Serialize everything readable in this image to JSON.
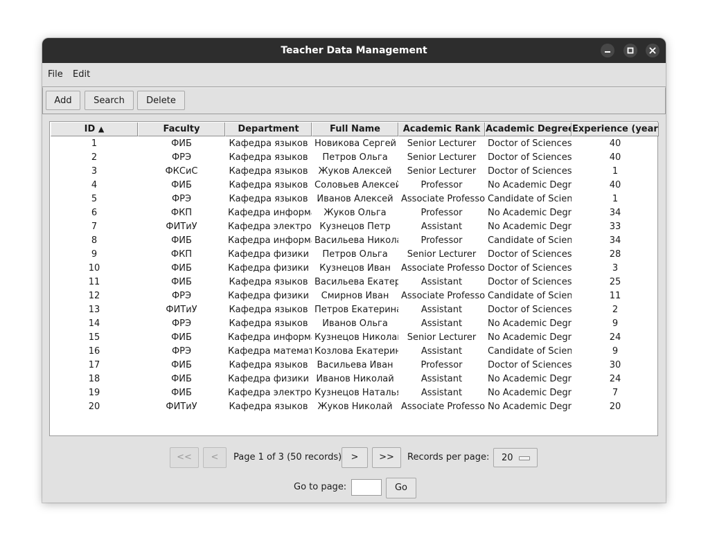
{
  "window": {
    "title": "Teacher Data Management",
    "controls": {
      "minimize": "minimize-icon",
      "maximize": "maximize-icon",
      "close": "close-icon"
    }
  },
  "menu": [
    "File",
    "Edit"
  ],
  "toolbar": {
    "add_label": "Add",
    "search_label": "Search",
    "delete_label": "Delete"
  },
  "table": {
    "columns": [
      "ID",
      "Faculty",
      "Department",
      "Full Name",
      "Academic Rank",
      "Academic Degree",
      "Experience (years)"
    ],
    "sort": {
      "column": "ID",
      "indicator": "▲"
    },
    "rows": [
      [
        "1",
        "ФИБ",
        "Кафедра языков",
        "Новикова Сергей",
        "Senior Lecturer",
        "Doctor of Sciences",
        "40"
      ],
      [
        "2",
        "ФРЭ",
        "Кафедра языков",
        "Петров Ольга",
        "Senior Lecturer",
        "Doctor of Sciences",
        "40"
      ],
      [
        "3",
        "ФКСиС",
        "Кафедра языков",
        "Жуков Алексей",
        "Senior Lecturer",
        "Doctor of Sciences",
        "1"
      ],
      [
        "4",
        "ФИБ",
        "Кафедра языков",
        "Соловьев Алексей",
        "Professor",
        "No Academic Degree",
        "40"
      ],
      [
        "5",
        "ФРЭ",
        "Кафедра языков",
        "Иванов Алексей",
        "Associate Professor",
        "Candidate of Sciences",
        "1"
      ],
      [
        "6",
        "ФКП",
        "Кафедра информатики",
        "Жуков Ольга",
        "Professor",
        "No Academic Degree",
        "34"
      ],
      [
        "7",
        "ФИТиУ",
        "Кафедра электроники",
        "Кузнецов Петр",
        "Assistant",
        "No Academic Degree",
        "33"
      ],
      [
        "8",
        "ФИБ",
        "Кафедра информатики",
        "Васильева Николай",
        "Professor",
        "Candidate of Sciences",
        "34"
      ],
      [
        "9",
        "ФКП",
        "Кафедра физики",
        "Петров Ольга",
        "Senior Lecturer",
        "Doctor of Sciences",
        "28"
      ],
      [
        "10",
        "ФИБ",
        "Кафедра физики",
        "Кузнецов Иван",
        "Associate Professor",
        "Doctor of Sciences",
        "3"
      ],
      [
        "11",
        "ФИБ",
        "Кафедра языков",
        "Васильева Екатерина",
        "Assistant",
        "Doctor of Sciences",
        "25"
      ],
      [
        "12",
        "ФРЭ",
        "Кафедра физики",
        "Смирнов Иван",
        "Associate Professor",
        "Candidate of Sciences",
        "11"
      ],
      [
        "13",
        "ФИТиУ",
        "Кафедра языков",
        "Петров Екатерина",
        "Assistant",
        "Doctor of Sciences",
        "2"
      ],
      [
        "14",
        "ФРЭ",
        "Кафедра языков",
        "Иванов Ольга",
        "Assistant",
        "No Academic Degree",
        "9"
      ],
      [
        "15",
        "ФИБ",
        "Кафедра информатики",
        "Кузнецов Николай",
        "Senior Lecturer",
        "No Academic Degree",
        "24"
      ],
      [
        "16",
        "ФРЭ",
        "Кафедра математики",
        "Козлова Екатерина",
        "Assistant",
        "Candidate of Sciences",
        "9"
      ],
      [
        "17",
        "ФИБ",
        "Кафедра языков",
        "Васильева Иван",
        "Professor",
        "Doctor of Sciences",
        "30"
      ],
      [
        "18",
        "ФИБ",
        "Кафедра физики",
        "Иванов Николай",
        "Assistant",
        "No Academic Degree",
        "24"
      ],
      [
        "19",
        "ФИБ",
        "Кафедра электроники",
        "Кузнецов Наталья",
        "Assistant",
        "No Academic Degree",
        "7"
      ],
      [
        "20",
        "ФИТиУ",
        "Кафедра языков",
        "Жуков Николай",
        "Associate Professor",
        "No Academic Degree",
        "20"
      ]
    ]
  },
  "pagination": {
    "first_label": "<<",
    "prev_label": "<",
    "page_info": "Page 1 of 3 (50 records)",
    "next_label": ">",
    "last_label": ">>",
    "per_page_label": "Records per page:",
    "per_page_value": "20",
    "goto_label": "Go to page:",
    "goto_value": "",
    "go_label": "Go"
  }
}
